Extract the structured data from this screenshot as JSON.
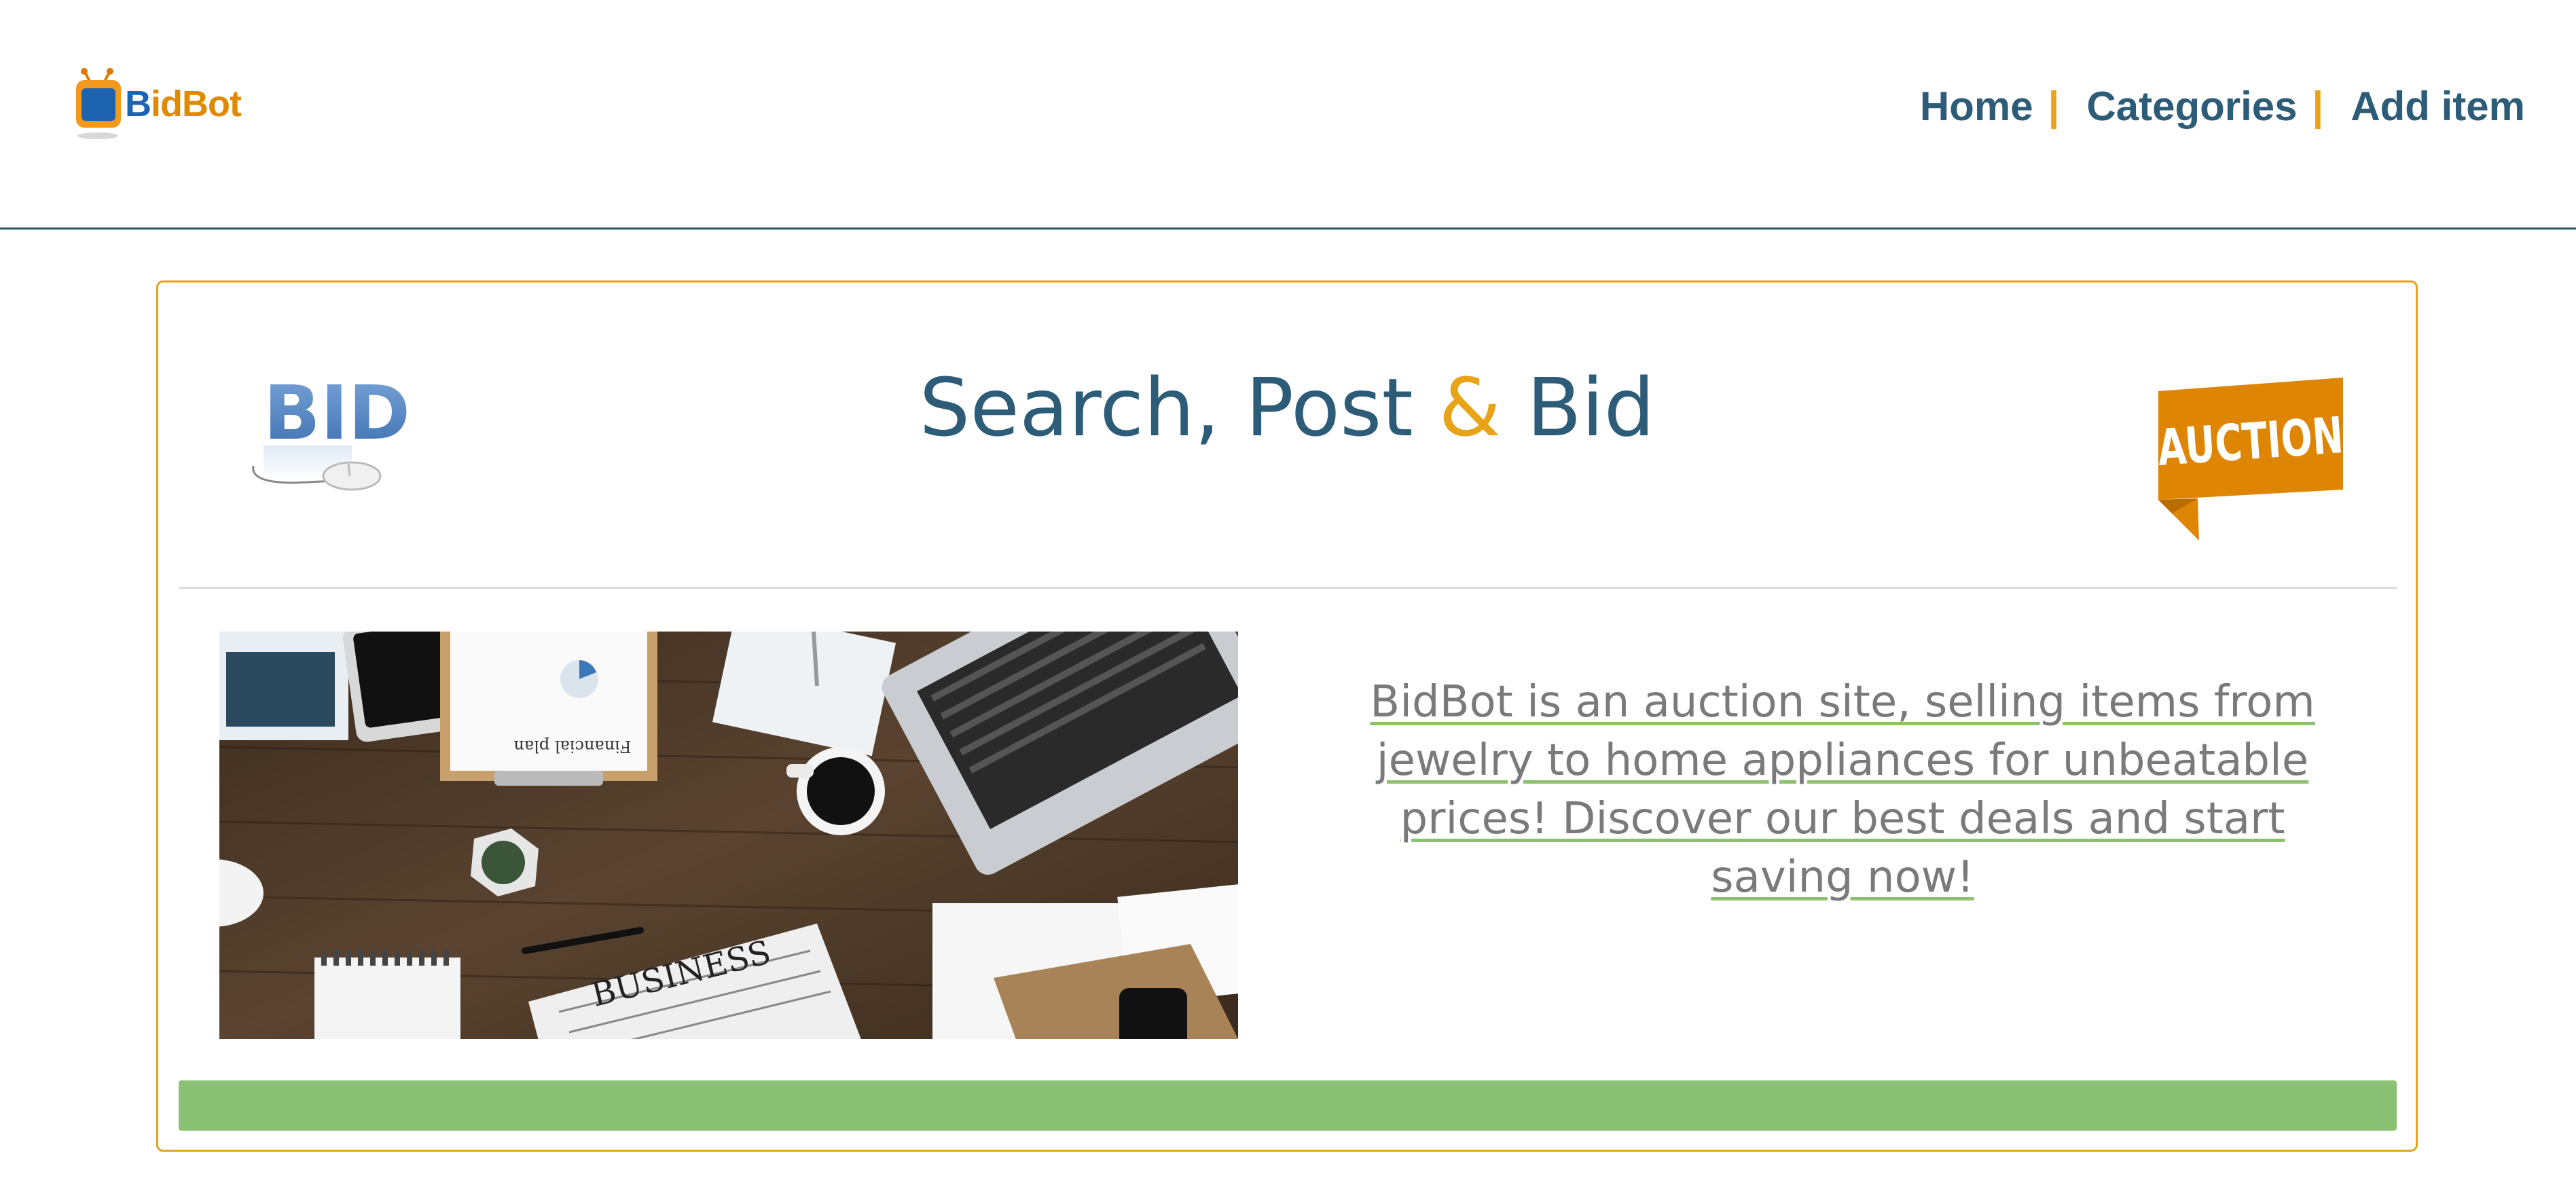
{
  "header": {
    "logo": {
      "first_letter": "B",
      "rest": "idBot"
    },
    "nav": {
      "items": [
        {
          "label": "Home"
        },
        {
          "label": "Categories"
        },
        {
          "label": "Add item"
        }
      ],
      "separator": "|"
    }
  },
  "hero": {
    "title_part1": "Search, Post ",
    "title_amp": "&",
    "title_part2": " Bid",
    "bid_logo_text": "BID",
    "auction_flag_text": "AUCTION",
    "photo_newspaper_text": "BUSINESS",
    "photo_document_text": "Financial plan",
    "description": "BidBot is an auction site, selling items from jewelry to home appliances for unbeatable prices! Discover our best deals and start saving now!"
  },
  "colors": {
    "primary": "#2d5c78",
    "accent": "#e8a317",
    "green": "#8bc175",
    "text_gray": "#7a7a7a"
  }
}
